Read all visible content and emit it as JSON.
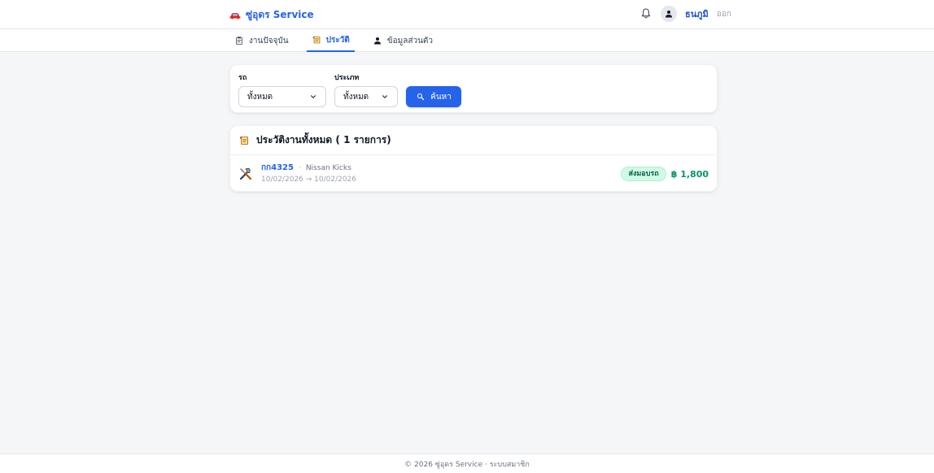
{
  "header": {
    "brand_text": "ซู่อุดร Service",
    "brand_icon": "car-icon",
    "bell_icon": "bell-icon",
    "avatar_icon": "user-icon",
    "username": "ธนภูมิ",
    "logout_label": "ออก"
  },
  "tabs": [
    {
      "label": "งานปัจจุบัน",
      "icon": "clipboard-icon",
      "active": false
    },
    {
      "label": "ประวัติ",
      "icon": "scroll-icon",
      "active": true
    },
    {
      "label": "ข้อมูลส่วนตัว",
      "icon": "user-icon",
      "active": false
    }
  ],
  "filters": {
    "vehicle_label": "รถ",
    "vehicle_value": "ทั้งหมด",
    "type_label": "ประเภท",
    "type_value": "ทั้งหมด",
    "search_label": "ค้นหา",
    "search_icon": "search-icon"
  },
  "history": {
    "title": "ประวัติงานทั้งหมด ( 1 รายการ)",
    "title_icon": "scroll-icon",
    "items": [
      {
        "icon": "tools-icon",
        "plate": "กก4325",
        "separator": "·",
        "model": "Nissan Kicks",
        "dates": "10/02/2026 → 10/02/2026",
        "status": "ส่งมอบรถ",
        "amount": "฿ 1,800"
      }
    ]
  },
  "footer": {
    "text": "© 2026 ซู่อุดร Service · ระบบสมาชิก"
  },
  "colors": {
    "primary": "#2563eb",
    "success": "#059669",
    "success_bg": "#d1fae5",
    "page_bg": "#f5f6f8"
  }
}
